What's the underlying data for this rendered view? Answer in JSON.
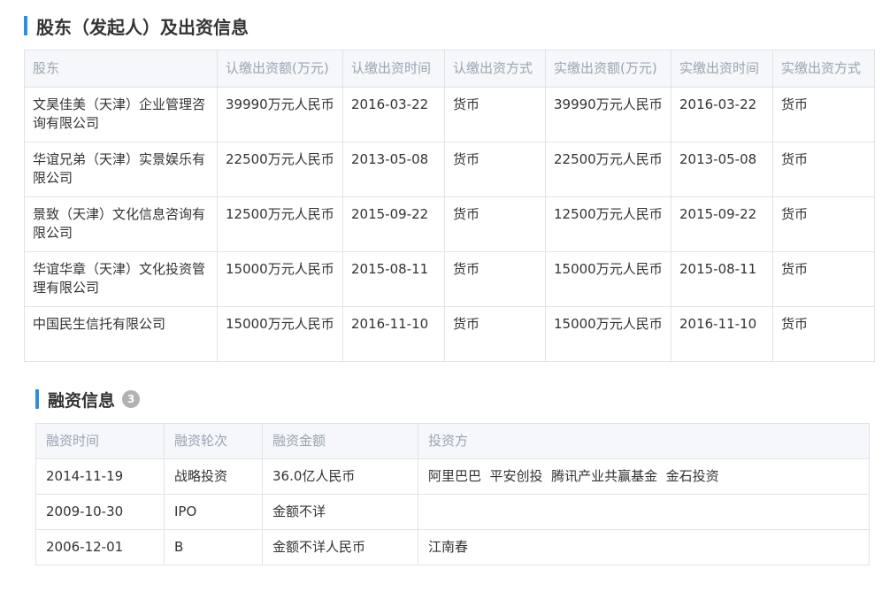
{
  "shareholders": {
    "title": "股东（发起人）及出资信息",
    "headers": [
      "股东",
      "认缴出资额(万元)",
      "认缴出资时间",
      "认缴出资方式",
      "实缴出资额(万元)",
      "实缴出资时间",
      "实缴出资方式"
    ],
    "rows": [
      [
        "文昊佳美（天津）企业管理咨询有限公司",
        "39990万元人民币",
        "2016-03-22",
        "货币",
        "39990万元人民币",
        "2016-03-22",
        "货币"
      ],
      [
        "华谊兄弟（天津）实景娱乐有限公司",
        "22500万元人民币",
        "2013-05-08",
        "货币",
        "22500万元人民币",
        "2013-05-08",
        "货币"
      ],
      [
        "景致（天津）文化信息咨询有限公司",
        "12500万元人民币",
        "2015-09-22",
        "货币",
        "12500万元人民币",
        "2015-09-22",
        "货币"
      ],
      [
        "华谊华章（天津）文化投资管理有限公司",
        "15000万元人民币",
        "2015-08-11",
        "货币",
        "15000万元人民币",
        "2015-08-11",
        "货币"
      ],
      [
        "中国民生信托有限公司",
        "15000万元人民币",
        "2016-11-10",
        "货币",
        "15000万元人民币",
        "2016-11-10",
        "货币"
      ]
    ]
  },
  "financing": {
    "title": "融资信息",
    "count": "3",
    "headers": [
      "融资时间",
      "融资轮次",
      "融资金额",
      "投资方"
    ],
    "rows": [
      [
        "2014-11-19",
        "战略投资",
        "36.0亿人民币",
        "阿里巴巴  平安创投  腾讯产业共赢基金  金石投资"
      ],
      [
        "2009-10-30",
        "IPO",
        "金额不详",
        ""
      ],
      [
        "2006-12-01",
        "B",
        "金额不详人民币",
        "江南春"
      ]
    ]
  },
  "colors": {
    "accent": "#2e8ee6",
    "header_bg": "#f5f7fa",
    "header_text": "#9aa5b1",
    "border": "#dfe3e8",
    "badge_bg": "#b2b2b2"
  }
}
